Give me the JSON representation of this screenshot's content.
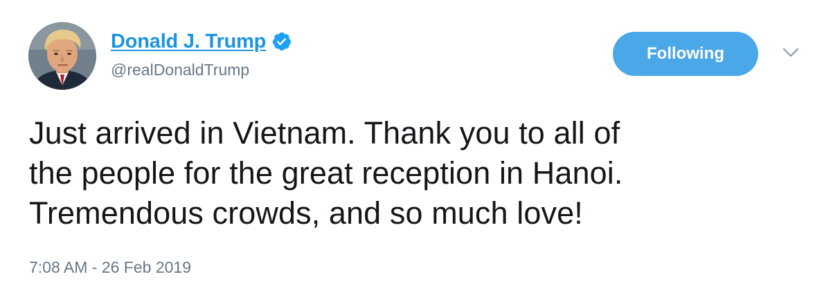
{
  "tweet": {
    "author": {
      "display_name": "Donald J. Trump",
      "handle": "@realDonaldTrump",
      "verified": true
    },
    "follow_button_label": "Following",
    "text": "Just arrived in Vietnam. Thank you to all of\nthe people for the great reception in Hanoi.\nTremendous crowds, and so much love!",
    "timestamp": "7:08 AM - 26 Feb 2019"
  },
  "icons": {
    "verified": "verified-badge-icon",
    "more": "chevron-down-icon",
    "avatar": "profile-photo"
  },
  "colors": {
    "link_blue": "#1b95e0",
    "button_blue": "#4aa8e8",
    "muted_gray": "#657786",
    "text_dark": "#14171a"
  }
}
